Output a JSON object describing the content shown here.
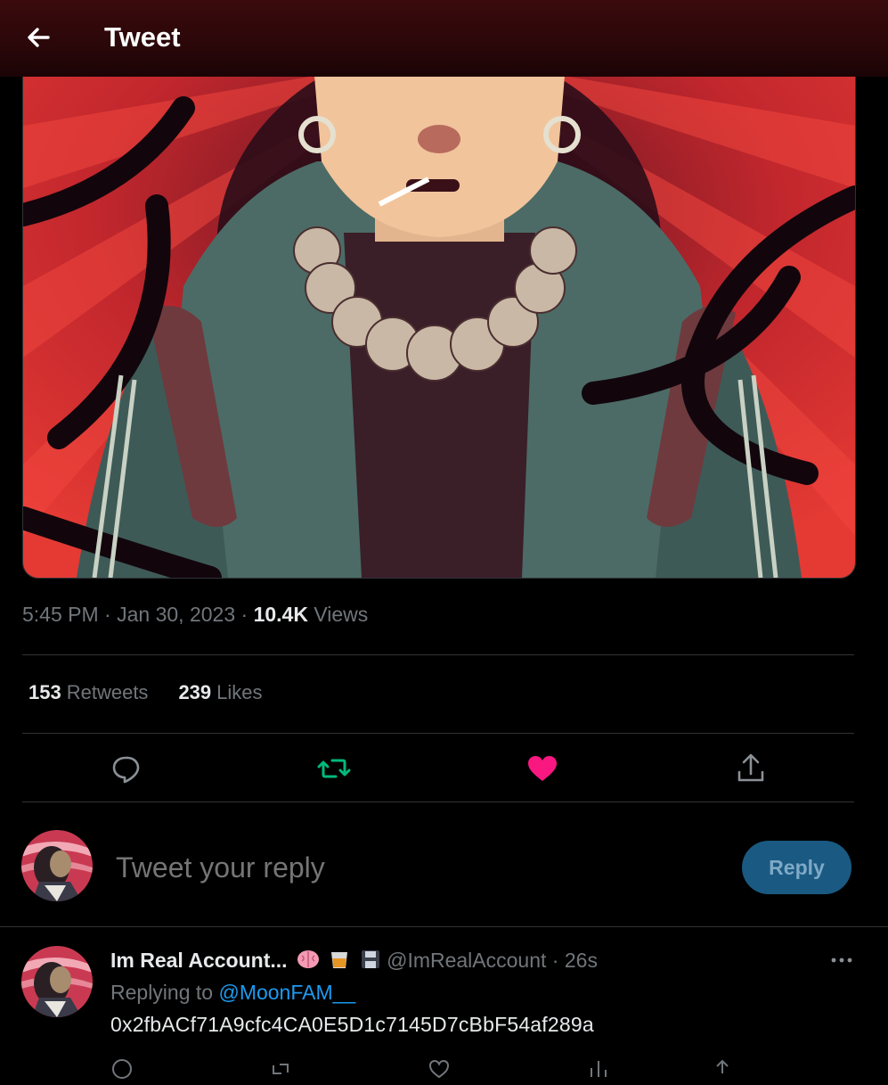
{
  "header": {
    "title": "Tweet",
    "back_icon": "arrow-left-icon"
  },
  "tweet": {
    "media_description": "illustration",
    "time": "5:45 PM",
    "date": "Jan 30, 2023",
    "views_count": "10.4K",
    "views_label": "Views",
    "retweets_count": "153",
    "retweets_label": "Retweets",
    "likes_count": "239",
    "likes_label": "Likes",
    "liked": true
  },
  "actions": {
    "reply_icon": "comment-icon",
    "retweet_icon": "retweet-icon",
    "like_icon": "heart-icon",
    "share_icon": "share-icon"
  },
  "composer": {
    "placeholder": "Tweet your reply",
    "button_label": "Reply"
  },
  "reply": {
    "display_name": "Im Real Account...",
    "emojis": [
      "brain-emoji",
      "whiskey-emoji",
      "floppy-disk-emoji"
    ],
    "handle": "@ImRealAccount",
    "separator": "·",
    "time": "26s",
    "replying_prefix": "Replying to",
    "replying_to": "@MoonFAM__",
    "text": "0x2fbACf71A9cfc4CA0E5D1c7145D7cBbF54af289a"
  },
  "colors": {
    "background": "#000000",
    "accent": "#1d9bf0",
    "like": "#f91880",
    "retweet": "#00ba7c",
    "muted": "#71767b"
  }
}
